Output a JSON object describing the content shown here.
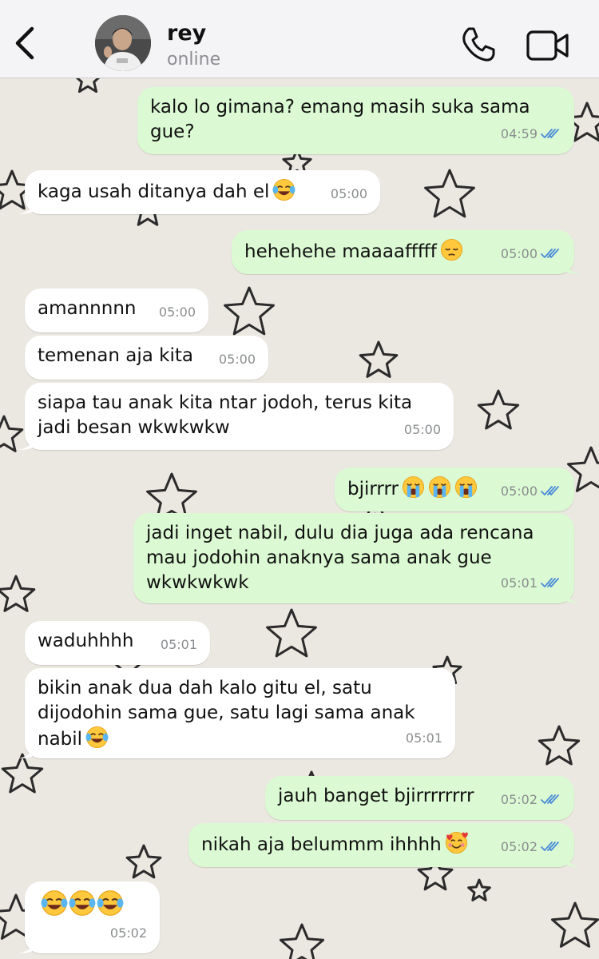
{
  "contact": {
    "name": "rey",
    "status": "online"
  },
  "icons": {
    "back": "chevron-left-icon",
    "call": "phone-icon",
    "video": "video-camera-icon"
  },
  "colors": {
    "incoming": "#ffffff",
    "outgoing": "#dbfad3",
    "read_tick": "#4a8bd8",
    "background": "#ebe7e1"
  },
  "messages": [
    {
      "dir": "out",
      "text": "kalo lo gimana? emang masih suka sama gue?",
      "time": "04:59",
      "read": true
    },
    {
      "dir": "in",
      "text": "kaga usah ditanya dah el",
      "emoji": "face-with-tears-of-joy",
      "time": "05:00"
    },
    {
      "dir": "out",
      "text": "hehehehe maaaafffff",
      "emoji": "pensive-face",
      "time": "05:00",
      "read": true
    },
    {
      "dir": "in",
      "text": "amannnnn",
      "time": "05:00"
    },
    {
      "dir": "in",
      "text": "temenan aja kita",
      "time": "05:00"
    },
    {
      "dir": "in",
      "text": "siapa tau anak kita ntar jodoh, terus kita jadi besan wkwkwkw",
      "time": "05:00"
    },
    {
      "dir": "out",
      "text": "bjirrrr",
      "emoji": "loudly-crying-face x3",
      "time": "05:00",
      "read": true
    },
    {
      "dir": "out",
      "text": "jadi inget nabil, dulu dia juga ada rencana mau jodohin anaknya sama anak gue wkwkwkwk",
      "time": "05:01",
      "read": true
    },
    {
      "dir": "in",
      "text": "waduhhhh",
      "time": "05:01"
    },
    {
      "dir": "in",
      "text": "bikin anak dua dah kalo gitu el, satu dijodohin sama gue, satu lagi sama anak nabil",
      "emoji": "face-with-tears-of-joy",
      "time": "05:01"
    },
    {
      "dir": "out",
      "text": "jauh banget bjirrrrrrrr",
      "time": "05:02",
      "read": true
    },
    {
      "dir": "out",
      "text": "nikah aja belummm ihhhh",
      "emoji": "smiling-face-with-hearts",
      "time": "05:02",
      "read": true
    },
    {
      "dir": "in",
      "text": "",
      "emoji": "face-with-tears-of-joy x3",
      "time": "05:02"
    }
  ]
}
